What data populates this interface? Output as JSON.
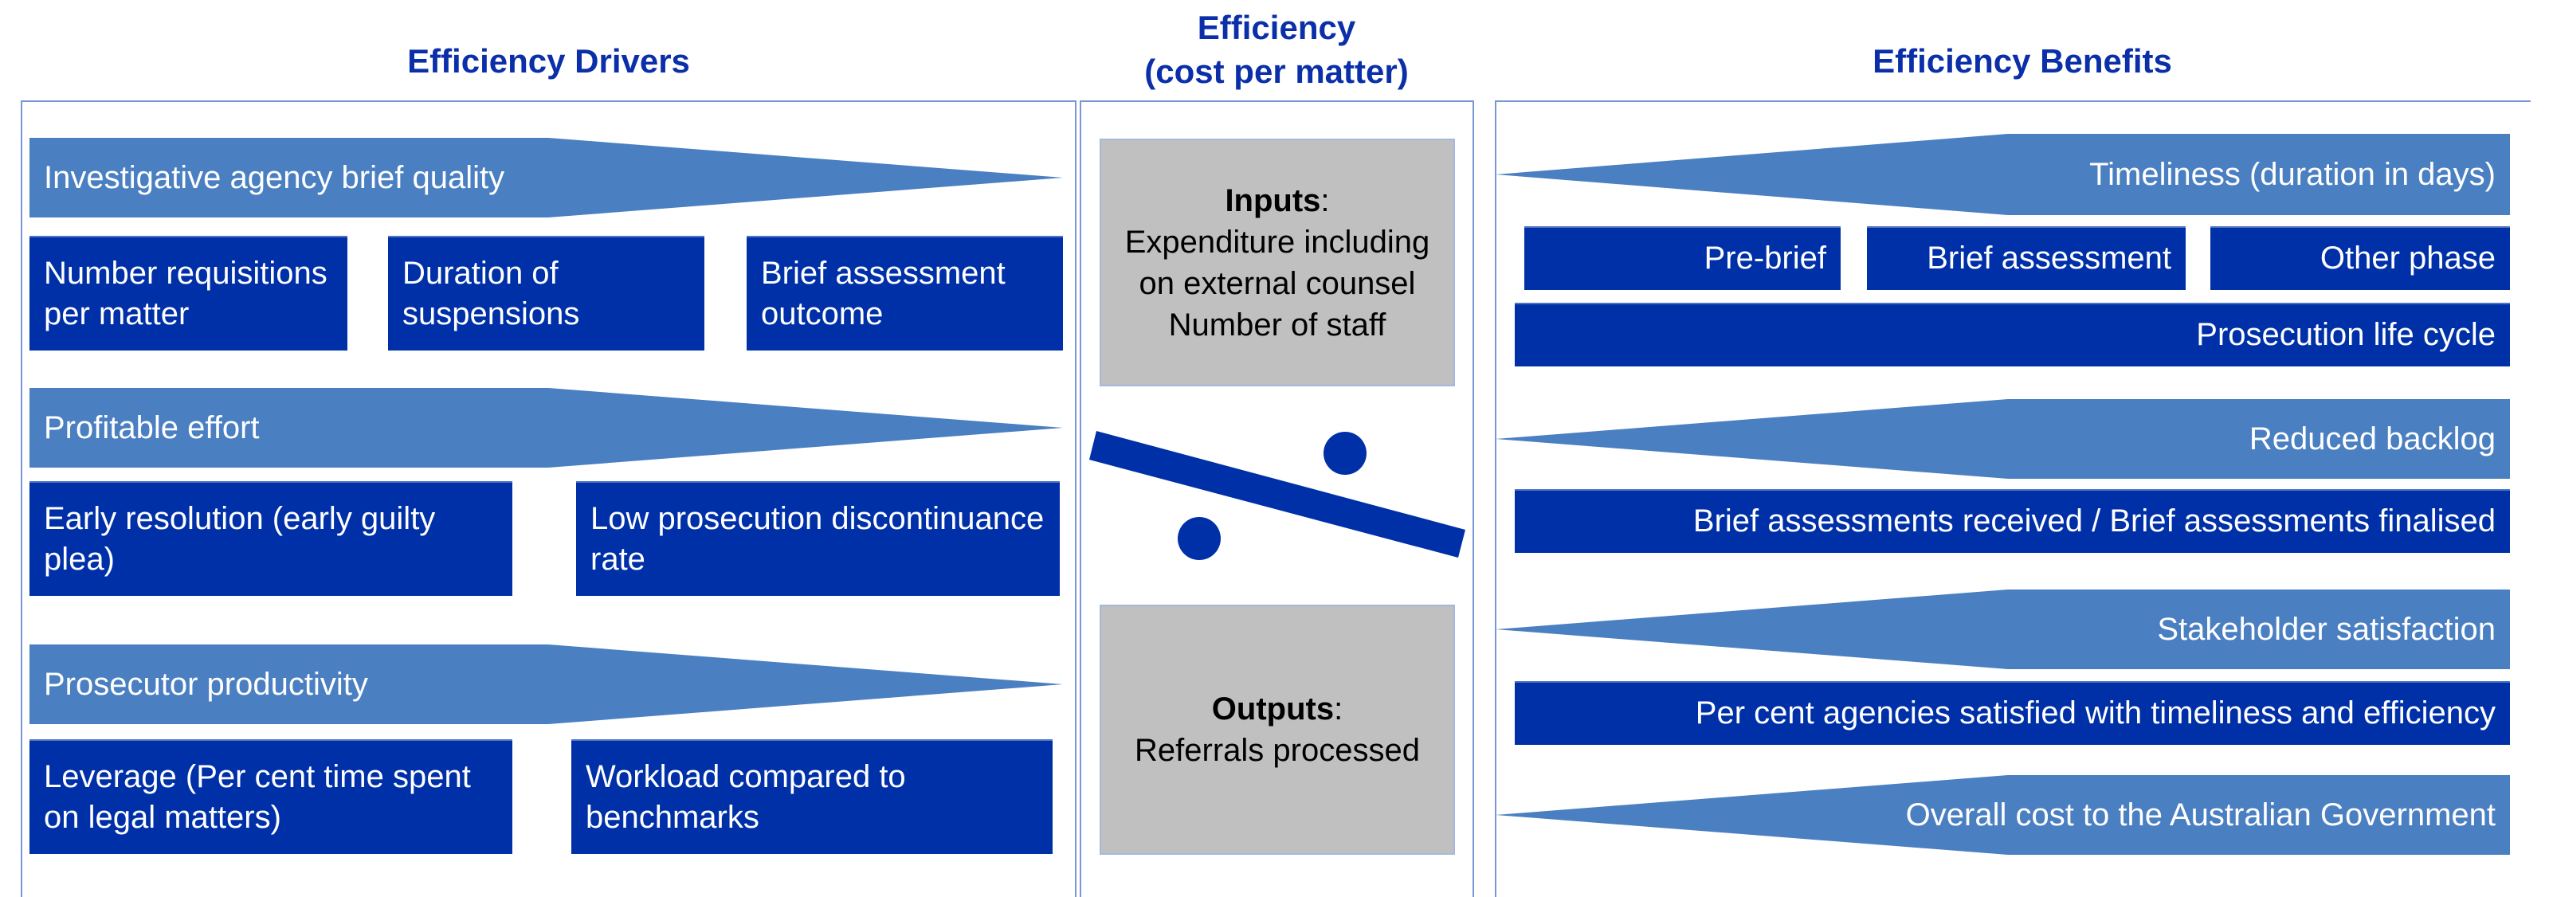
{
  "headers": {
    "drivers": "Efficiency Drivers",
    "efficiency_line1": "Efficiency",
    "efficiency_line2": "(cost per matter)",
    "benefits": "Efficiency Benefits"
  },
  "colors": {
    "arrow_fill": "#4a7fc1",
    "box_fill": "#0030a8",
    "header_text": "#0a2fa8",
    "grey_box": "#c0c0c0",
    "panel_border": "#7a96d6"
  },
  "drivers": [
    {
      "label": "Investigative agency brief quality",
      "items": [
        "Number requisitions per matter",
        "Duration of suspensions",
        "Brief assessment outcome"
      ]
    },
    {
      "label": "Profitable effort",
      "items": [
        "Early resolution (early guilty plea)",
        "Low prosecution discontinuance rate"
      ]
    },
    {
      "label": "Prosecutor productivity",
      "items": [
        "Leverage (Per cent time spent on legal matters)",
        "Workload compared to benchmarks"
      ]
    }
  ],
  "efficiency": {
    "inputs": {
      "title": "Inputs",
      "colon": ":",
      "lines": [
        "Expenditure including",
        "on external counsel",
        "Number of staff"
      ]
    },
    "ratio_icon": "percent-division-icon",
    "outputs": {
      "title": "Outputs",
      "colon": ":",
      "lines": [
        "Referrals processed"
      ]
    }
  },
  "benefits": [
    {
      "label": "Timeliness (duration in days)",
      "phases": [
        "Pre-brief",
        "Brief assessment",
        "Other phase"
      ],
      "measure": "Prosecution life cycle"
    },
    {
      "label": "Reduced backlog",
      "measure": "Brief assessments received / Brief assessments finalised"
    },
    {
      "label": "Stakeholder satisfaction",
      "measure": "Per cent agencies satisfied with timeliness and efficiency"
    },
    {
      "label": "Overall cost to the Australian Government"
    }
  ]
}
